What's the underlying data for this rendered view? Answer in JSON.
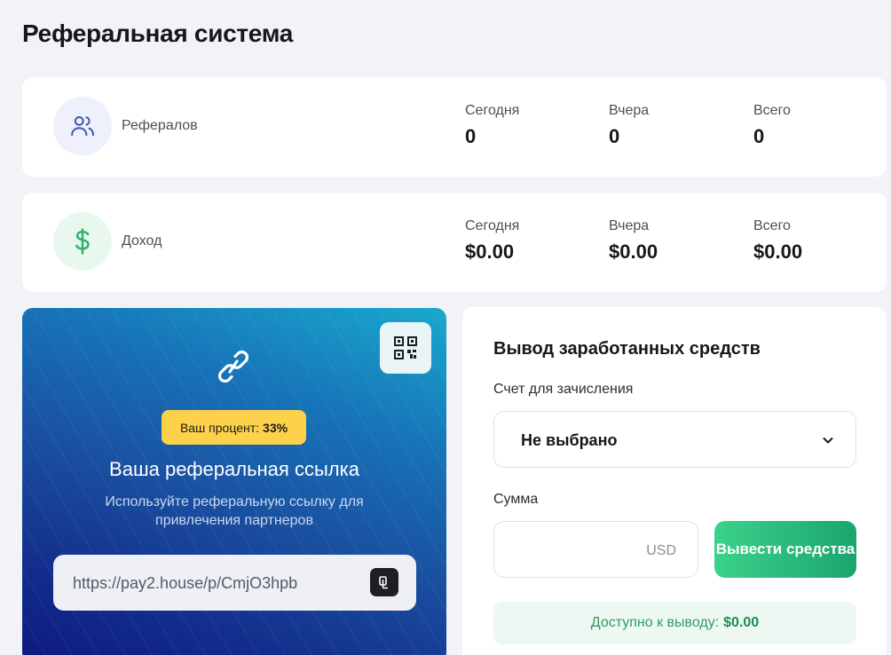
{
  "page": {
    "title": "Реферальная система"
  },
  "referrals": {
    "label": "Рефералов",
    "icon": "users-icon",
    "today_label": "Сегодня",
    "today_value": "0",
    "yesterday_label": "Вчера",
    "yesterday_value": "0",
    "total_label": "Всего",
    "total_value": "0"
  },
  "income": {
    "label": "Доход",
    "icon": "dollar-icon",
    "today_label": "Сегодня",
    "today_value": "$0.00",
    "yesterday_label": "Вчера",
    "yesterday_value": "$0.00",
    "total_label": "Всего",
    "total_value": "$0.00"
  },
  "referral_link": {
    "percent_label": "Ваш процент:",
    "percent_value": "33%",
    "title": "Ваша реферальная ссылка",
    "description": "Используйте реферальную ссылку для привлечения партнеров",
    "url": "https://pay2.house/p/CmjO3hpb",
    "icons": [
      "link-icon",
      "qr-code-icon",
      "copy-icon"
    ]
  },
  "withdraw": {
    "title": "Вывод заработанных средств",
    "account_label": "Счет для зачисления",
    "account_value": "Не выбрано",
    "amount_label": "Сумма",
    "amount_value": "",
    "currency": "USD",
    "button_label": "Вывести средства",
    "available_label": "Доступно к выводу:",
    "available_value": "$0.00"
  },
  "colors": {
    "background": "#f2f3f6",
    "badge": "#fdd14a",
    "green_accent": "#1aa56f",
    "link_card_top": "#19a9cf",
    "link_card_bottom": "#0d1a7d"
  }
}
